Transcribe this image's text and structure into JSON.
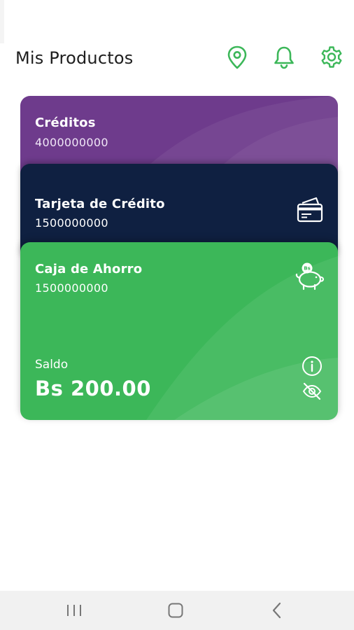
{
  "header": {
    "title": "Mis Productos",
    "icons": [
      "location-pin-icon",
      "bell-icon",
      "gear-icon"
    ]
  },
  "cards": [
    {
      "title": "Créditos",
      "number": "4000000000",
      "color": "#6e3b8c"
    },
    {
      "title": "Tarjeta de Crédito",
      "number": "1500000000",
      "color": "#0f2041",
      "icon": "credit-card-icon"
    },
    {
      "title": "Caja de Ahorro",
      "number": "1500000000",
      "color": "#3cb759",
      "icon": "piggy-bank-icon",
      "badge": "Bs",
      "balance_label": "Saldo",
      "balance_value": "Bs 200.00"
    }
  ],
  "colors": {
    "accent": "#3cb759",
    "text": "#1e1e1e",
    "navbar": "#f1f1f1"
  },
  "navbar": {
    "buttons": [
      "recents-icon",
      "home-icon",
      "back-icon"
    ]
  }
}
